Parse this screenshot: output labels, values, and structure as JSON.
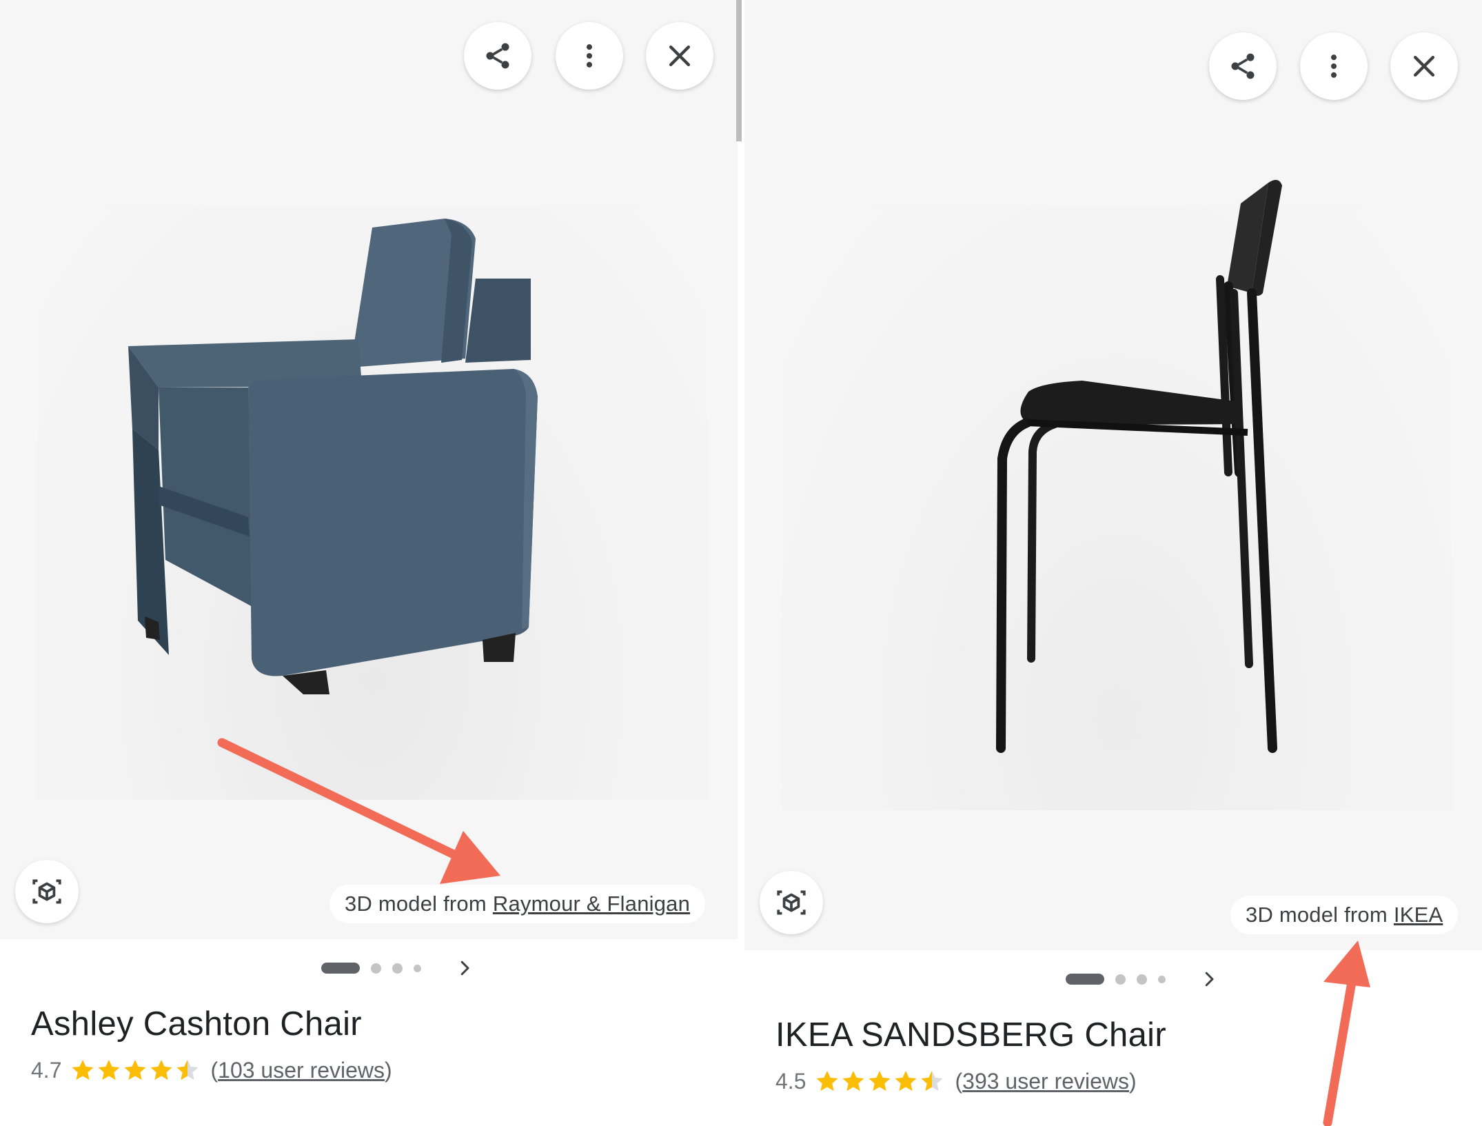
{
  "colors": {
    "viewer_bg": "#f6f6f6",
    "star": "#fbbc04",
    "star_empty": "#dadce0",
    "annotation_arrow": "#f26b57",
    "sofa": "#4a6074",
    "chair": "#1a1a1a"
  },
  "left": {
    "toolbar": {
      "share_icon": "share-icon",
      "more_icon": "more-vert-icon",
      "close_icon": "close-icon"
    },
    "ar_icon": "view-in-3d-cube-icon",
    "attribution": {
      "prefix": "3D model from",
      "source": "Raymour & Flanigan"
    },
    "pager": {
      "active_index": 0,
      "count": 4
    },
    "product": {
      "title": "Ashley Cashton Chair",
      "rating": "4.7",
      "rating_stars": 4.7,
      "reviews_open": "(",
      "reviews_link": "103 user reviews",
      "reviews_close": ")"
    }
  },
  "right": {
    "toolbar": {
      "share_icon": "share-icon",
      "more_icon": "more-vert-icon",
      "close_icon": "close-icon"
    },
    "ar_icon": "view-in-3d-cube-icon",
    "attribution": {
      "prefix": "3D model from",
      "source": "IKEA"
    },
    "pager": {
      "active_index": 0,
      "count": 4
    },
    "product": {
      "title": "IKEA SANDSBERG Chair",
      "rating": "4.5",
      "rating_stars": 4.5,
      "reviews_open": "(",
      "reviews_link": "393 user reviews",
      "reviews_close": ")"
    }
  }
}
